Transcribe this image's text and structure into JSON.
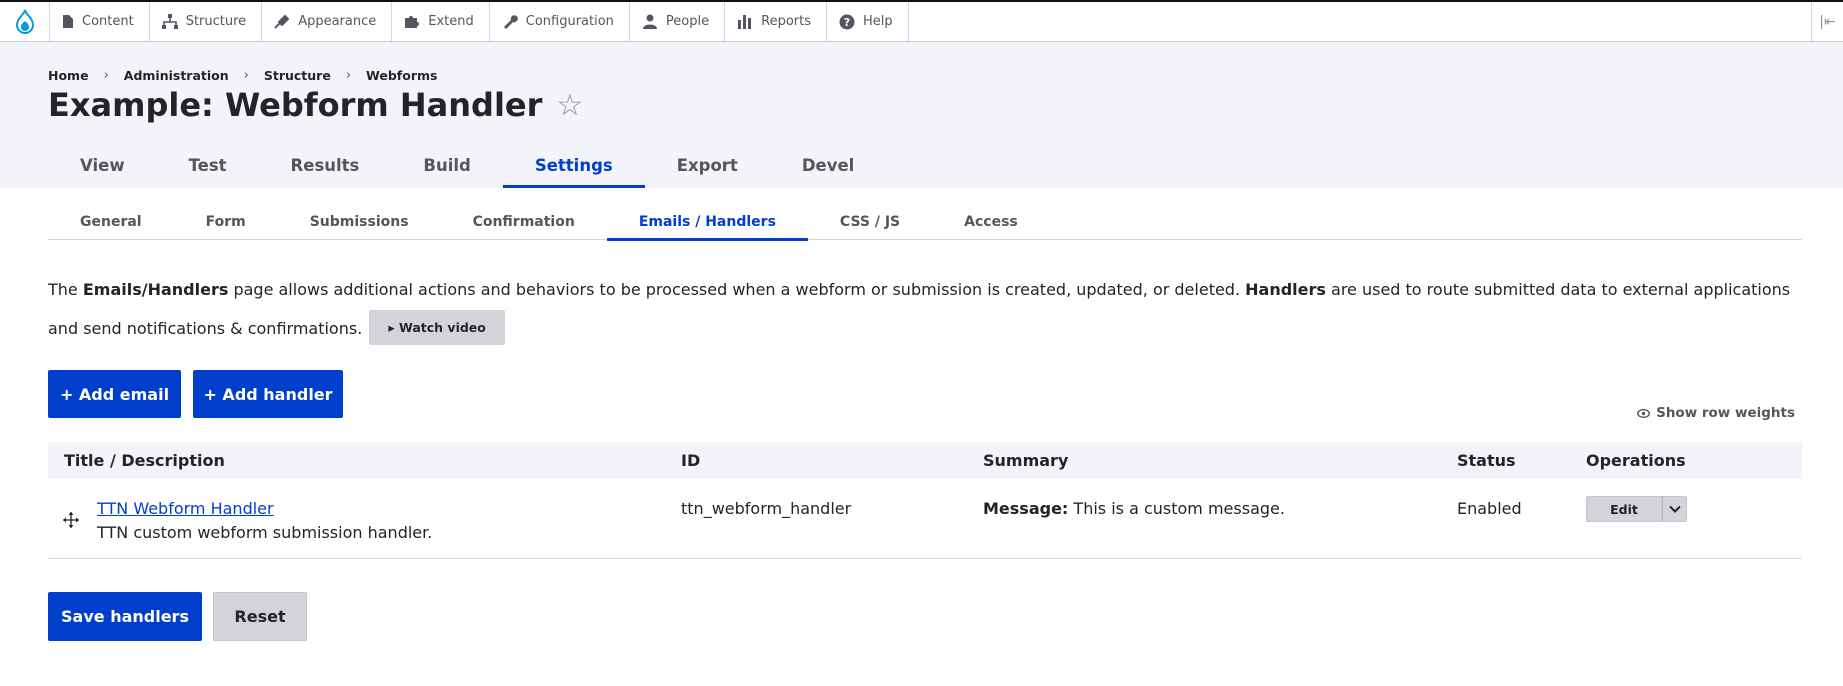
{
  "toolbar": {
    "items": [
      {
        "label": "Content",
        "icon": "file-icon"
      },
      {
        "label": "Structure",
        "icon": "sitemap-icon"
      },
      {
        "label": "Appearance",
        "icon": "paint-icon"
      },
      {
        "label": "Extend",
        "icon": "puzzle-icon"
      },
      {
        "label": "Configuration",
        "icon": "wrench-icon"
      },
      {
        "label": "People",
        "icon": "person-icon"
      },
      {
        "label": "Reports",
        "icon": "bar-chart-icon"
      },
      {
        "label": "Help",
        "icon": "help-icon"
      }
    ]
  },
  "breadcrumb": [
    "Home",
    "Administration",
    "Structure",
    "Webforms"
  ],
  "page_title": "Example: Webform Handler",
  "primary_tabs": [
    "View",
    "Test",
    "Results",
    "Build",
    "Settings",
    "Export",
    "Devel"
  ],
  "primary_active": "Settings",
  "secondary_tabs": [
    "General",
    "Form",
    "Submissions",
    "Confirmation",
    "Emails / Handlers",
    "CSS / JS",
    "Access"
  ],
  "secondary_active": "Emails / Handlers",
  "description": {
    "part1": "The ",
    "bold1": "Emails/Handlers",
    "part2": " page allows additional actions and behaviors to be processed when a webform or submission is created, updated, or deleted. ",
    "bold2": "Handlers",
    "part3": " are used to route submitted data to external applications and send notifications & confirmations.",
    "watch_video": "▸ Watch video"
  },
  "actions": {
    "add_email": "+ Add email",
    "add_handler": "+ Add handler",
    "show_row_weights": "Show row weights"
  },
  "table": {
    "headers": [
      "Title / Description",
      "ID",
      "Summary",
      "Status",
      "Operations"
    ],
    "rows": [
      {
        "title": "TTN Webform Handler",
        "description": "TTN custom webform submission handler.",
        "id": "ttn_webform_handler",
        "summary_label": "Message:",
        "summary_value": " This is a custom message.",
        "status": "Enabled",
        "operation": "Edit"
      }
    ]
  },
  "footer": {
    "save": "Save handlers",
    "reset": "Reset"
  },
  "colors": {
    "accent": "#003ecc",
    "header_bg": "#f3f4f9",
    "button_gray": "#d3d4d9",
    "drupal_blue": "#009cde"
  }
}
